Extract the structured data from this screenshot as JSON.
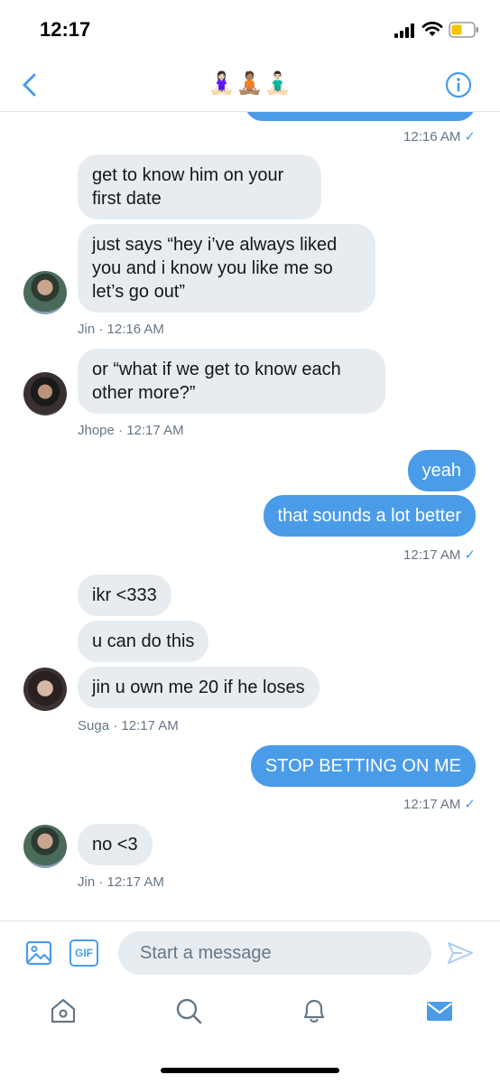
{
  "status_bar": {
    "time": "12:17",
    "battery_color": "#f5c400"
  },
  "header": {
    "title_emoji": "🧘🏻‍♀️🧘🏽🧘🏻‍♂️"
  },
  "colors": {
    "accent": "#4a9ce8",
    "incoming_bubble": "#e6ecf0",
    "meta_text": "#657786"
  },
  "thread": {
    "top_timestamp": "12:16 AM",
    "messages": [
      {
        "text": "get to know him on your\nfirst date"
      },
      {
        "text": "just says “hey i’ve always liked\nyou and i know you like me so\nlet’s go out”"
      },
      {
        "text": "or “what if we get to know each\nother more?”"
      },
      {
        "text": "yeah"
      },
      {
        "text": "that sounds a lot better"
      },
      {
        "text": "ikr <333"
      },
      {
        "text": "u can do this"
      },
      {
        "text": "jin u own me 20 if he loses"
      },
      {
        "text": "STOP BETTING ON ME"
      },
      {
        "text": "no <3"
      }
    ],
    "meta": [
      "Jin · 12:16 AM",
      "Jhope · 12:17 AM",
      "12:17 AM",
      "Suga · 12:17 AM",
      "12:17 AM",
      "Jin · 12:17 AM"
    ],
    "check_glyph": "✓"
  },
  "composer": {
    "placeholder": "Start a message",
    "gif_label": "GIF"
  },
  "tabbar": {
    "icons": [
      "home-icon",
      "search-icon",
      "notifications-icon",
      "messages-icon"
    ]
  }
}
